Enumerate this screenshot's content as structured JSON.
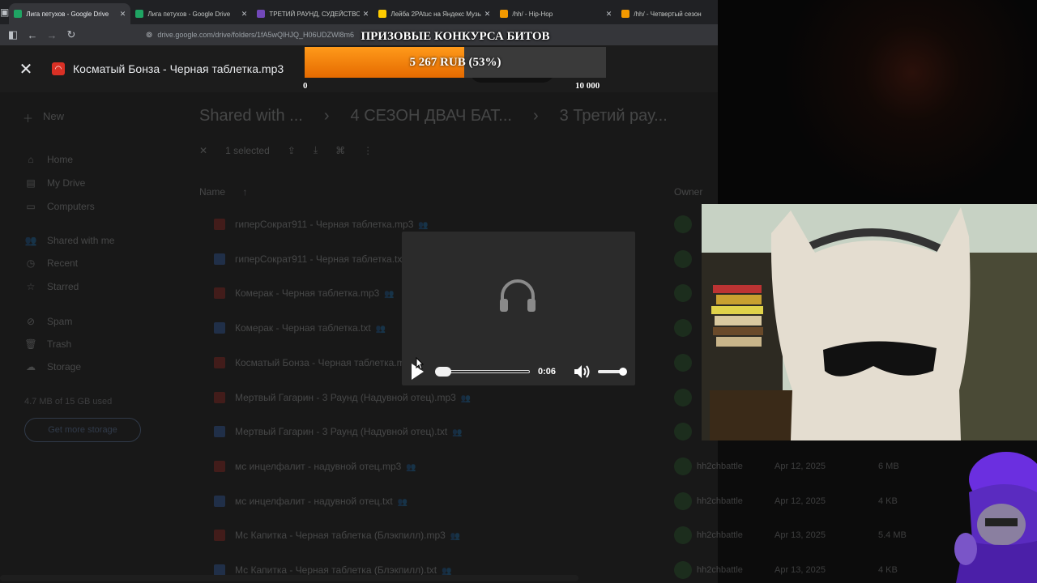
{
  "tabs": [
    {
      "title": "Лига петухов - Google Drive",
      "active": true,
      "favicon": "drive-icon"
    },
    {
      "title": "Лига петухов - Google Drive",
      "active": false,
      "favicon": "drive-icon"
    },
    {
      "title": "ТРЕТИЙ РАУНД, СУДЕЙСТВО /",
      "active": false,
      "favicon": "forms-icon"
    },
    {
      "title": "Лейба 2РАtuc на Яндекс Музы",
      "active": false,
      "favicon": "yandex-music-icon"
    },
    {
      "title": "/hh/ - Hip-Hop",
      "active": false,
      "favicon": "bolt-icon"
    },
    {
      "title": "/hh/ - Четвертый сезон",
      "active": false,
      "favicon": "bolt-icon"
    }
  ],
  "address": {
    "url": "drive.google.com/drive/folders/1fA5wQlHJQ_H06UDZWl8m6"
  },
  "viewer": {
    "file_title": "Косматый Бонза - Черная таблетка.mp3"
  },
  "drive": {
    "new_label": "New",
    "sidebar": [
      "Home",
      "My Drive",
      "Computers",
      "Shared with me",
      "Recent",
      "Starred",
      "Spam",
      "Trash",
      "Storage"
    ],
    "storage_text": "4.7 MB of 15 GB used",
    "more_storage": "Get more storage",
    "breadcrumbs": [
      "Shared with ...",
      "4 СЕЗОН ДВАЧ БАТ...",
      "3 Третий рау..."
    ],
    "selected_text": "1 selected",
    "columns": {
      "name": "Name",
      "owner": "Owner"
    },
    "files": [
      {
        "name": "гиперСократ911 - Черная таблетка.mp3",
        "type": "audio",
        "owner": "",
        "date": "",
        "size": ""
      },
      {
        "name": "гиперСократ911 - Черная таблетка.txt",
        "type": "text",
        "owner": "",
        "date": "",
        "size": ""
      },
      {
        "name": "Комерак - Черная таблетка.mp3",
        "type": "audio",
        "owner": "",
        "date": "",
        "size": ""
      },
      {
        "name": "Комерак - Черная таблетка.txt",
        "type": "text",
        "owner": "",
        "date": "",
        "size": ""
      },
      {
        "name": "Косматый Бонза - Черная таблетка.mp3",
        "type": "audio",
        "owner": "",
        "date": "",
        "size": ""
      },
      {
        "name": "Мертвый Гагарин - 3 Раунд (Надувной отец).mp3",
        "type": "audio",
        "owner": "",
        "date": "",
        "size": ""
      },
      {
        "name": "Мертвый Гагарин - 3 Раунд (Надувной отец).txt",
        "type": "text",
        "owner": "",
        "date": "",
        "size": ""
      },
      {
        "name": "мс инцелфалит - надувной отец.mp3",
        "type": "audio",
        "owner": "hh2chbattle",
        "date": "Apr 12, 2025",
        "size": "6 MB"
      },
      {
        "name": "мс инцелфалит - надувной отец.txt",
        "type": "text",
        "owner": "hh2chbattle",
        "date": "Apr 12, 2025",
        "size": "4 KB"
      },
      {
        "name": "Мс Капитка - Черная таблетка (Блэкпилл).mp3",
        "type": "audio",
        "owner": "hh2chbattle",
        "date": "Apr 13, 2025",
        "size": "5.4 MB"
      },
      {
        "name": "Мс Капитка - Черная таблетка (Блэкпилл).txt",
        "type": "text",
        "owner": "hh2chbattle",
        "date": "Apr 13, 2025",
        "size": "4 KB"
      }
    ]
  },
  "player": {
    "current_time": "0:06",
    "progress_fraction": 0.03,
    "volume_fraction": 0.85
  },
  "donation": {
    "title": "ПРИЗОВЫЕ КОНКУРСА БИТОВ",
    "label": "5 267 RUB (53%)",
    "current": 5267,
    "goal": 10000,
    "fraction": 0.53,
    "min_label": "0",
    "max_label": "10 000",
    "bar_color": "#f07d0a"
  },
  "colors": {
    "audio_icon": "#d93025",
    "text_icon": "#4285f4",
    "owner_avatar": "#2e7d32"
  }
}
